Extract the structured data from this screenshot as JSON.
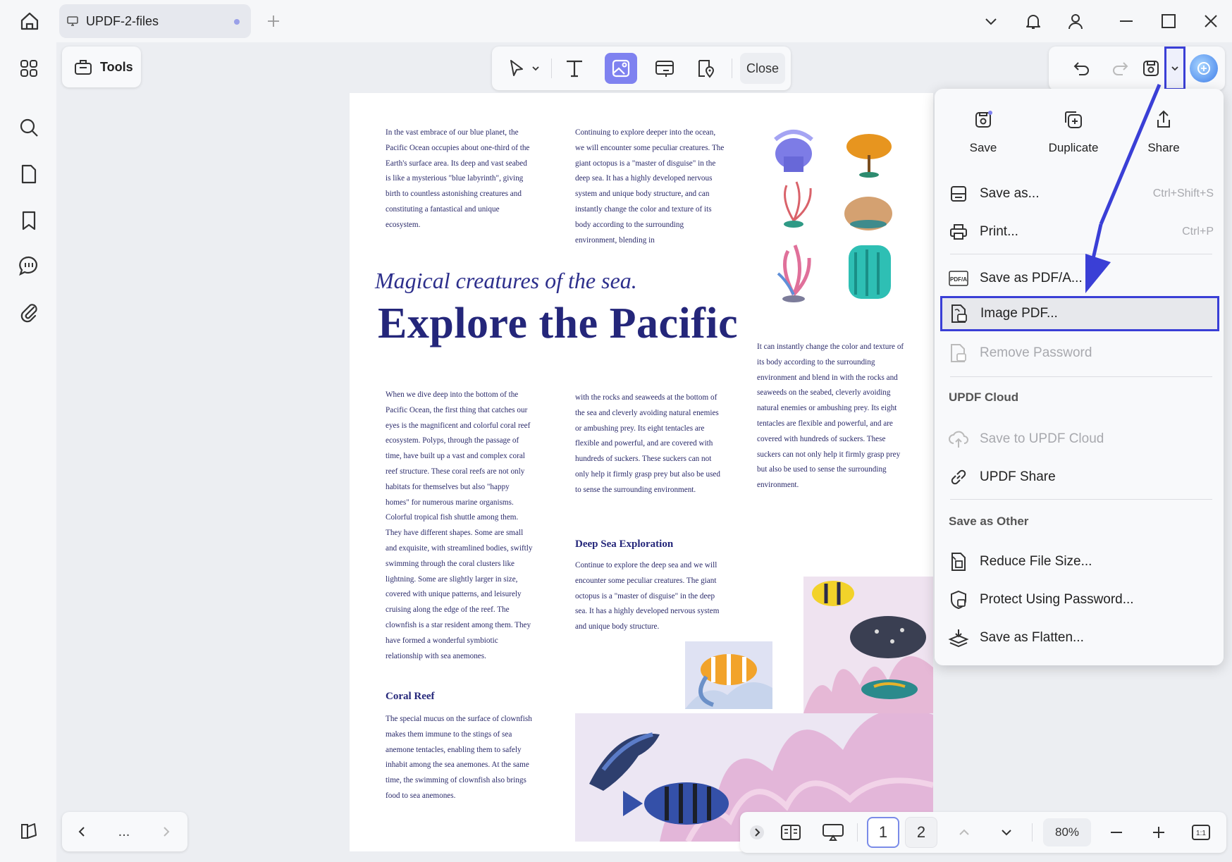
{
  "tab": {
    "title": "UPDF-2-files"
  },
  "toolbar": {
    "tools_label": "Tools",
    "close_label": "Close"
  },
  "menu": {
    "top": [
      {
        "label": "Save",
        "icon": "save-icon"
      },
      {
        "label": "Duplicate",
        "icon": "duplicate-icon"
      },
      {
        "label": "Share",
        "icon": "share-icon"
      }
    ],
    "items": {
      "save_as": {
        "label": "Save as...",
        "shortcut": "Ctrl+Shift+S"
      },
      "print": {
        "label": "Print...",
        "shortcut": "Ctrl+P"
      },
      "save_pdfa": {
        "label": "Save as PDF/A..."
      },
      "image_pdf": {
        "label": "Image PDF..."
      },
      "remove_password": {
        "label": "Remove Password"
      },
      "save_cloud": {
        "label": "Save to UPDF Cloud"
      },
      "updf_share": {
        "label": "UPDF Share"
      },
      "reduce": {
        "label": "Reduce File Size..."
      },
      "protect": {
        "label": "Protect Using Password..."
      },
      "flatten": {
        "label": "Save as Flatten..."
      }
    },
    "sections": {
      "cloud": "UPDF Cloud",
      "other": "Save as Other"
    }
  },
  "document": {
    "col1_top": "In the vast embrace of our blue planet, the Pacific Ocean occupies about one-third of the Earth's surface area. Its deep and vast seabed is like a mysterious \"blue labyrinth\", giving birth to countless astonishing creatures and constituting a fantastical and unique ecosystem.",
    "col2_top": "Continuing to explore deeper into the ocean, we will encounter some peculiar creatures. The giant octopus is a \"master of disguise\" in the deep sea. It has a highly developed nervous system and unique body structure, and can instantly change the color and texture of its body according to the surrounding environment, blending in",
    "subtitle": "Magical creatures of the sea.",
    "title": "Explore the Pacific",
    "col3_mid": "It can instantly change the color and texture of its body according to the surrounding environment and blend in with the rocks and seaweeds on the seabed, cleverly avoiding natural enemies or ambushing prey. Its eight tentacles are flexible and powerful, and are covered with hundreds of suckers. These suckers can not only help it firmly grasp prey but also be used to sense the surrounding environment.",
    "col1_mid": "When we dive deep into the bottom of the Pacific Ocean, the first thing that catches our eyes is the magnificent and colorful coral reef ecosystem. Polyps, through the passage of time, have built up a vast and complex coral reef structure. These coral reefs are not only habitats for themselves but also \"happy homes\" for numerous marine organisms. Colorful tropical fish shuttle among them. They have different shapes. Some are small and exquisite, with streamlined bodies, swiftly swimming through the coral clusters like lightning. Some are slightly larger in size, covered with unique patterns, and leisurely cruising along the edge of the reef. The clownfish is a star resident among them. They have formed a wonderful symbiotic relationship with sea anemones.",
    "col2_mid": "with the rocks and seaweeds at the bottom of the sea and cleverly avoiding natural enemies or ambushing prey. Its eight tentacles are flexible and powerful, and are covered with hundreds of suckers. These suckers can not only help it firmly grasp prey but also be used to sense the surrounding environment.",
    "heading_deep": "Deep Sea Exploration",
    "col2_deep": "Continue to explore the deep sea and we will encounter some peculiar creatures. The giant octopus is a \"master of disguise\" in the deep sea. It has a highly developed nervous system and unique body structure.",
    "heading_coral": "Coral Reef",
    "col1_coral": "The special mucus on the surface of clownfish makes them immune to the stings of sea anemone tentacles, enabling them to safely inhabit among the sea anemones. At the same time, the swimming of clownfish also brings food to sea anemones."
  },
  "pager": {
    "page1": "1",
    "page2": "2",
    "zoom": "80%",
    "ellipsis": "...",
    "fit": "1:1"
  },
  "colors": {
    "accent": "#7f82f0",
    "highlight_border": "#3a3fd6",
    "doc_text": "#24267a"
  }
}
